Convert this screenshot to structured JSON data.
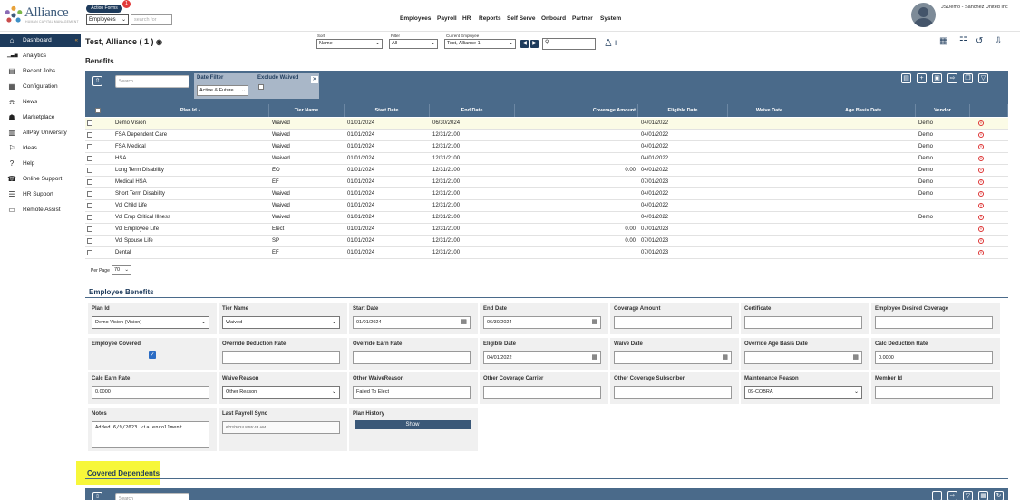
{
  "header": {
    "logo_text": "Alliance",
    "logo_subtext": "HUMAN CAPITAL MANAGEMENT",
    "action_forms": "Action Forms",
    "badge_count": "1",
    "employee_select": "Employees",
    "search_placeholder": "search for",
    "nav": [
      "Employees",
      "Payroll",
      "HR",
      "Reports",
      "Self Serve",
      "Onboard",
      "Partner",
      "System"
    ],
    "active_nav": "HR",
    "user_name": "JSDemo - Sanchez United Inc"
  },
  "sidebar": {
    "items": [
      {
        "label": "Dashboard",
        "icon": "home-icon"
      },
      {
        "label": "Analytics",
        "icon": "analytics-icon"
      },
      {
        "label": "Recent Jobs",
        "icon": "jobs-icon"
      },
      {
        "label": "Configuration",
        "icon": "configuration-icon"
      },
      {
        "label": "News",
        "icon": "bell-icon"
      },
      {
        "label": "Marketplace",
        "icon": "marketplace-icon"
      },
      {
        "label": "AllPay University",
        "icon": "university-icon"
      },
      {
        "label": "Ideas",
        "icon": "lightbulb-icon"
      },
      {
        "label": "Help",
        "icon": "help-icon"
      },
      {
        "label": "Online Support",
        "icon": "headset-icon"
      },
      {
        "label": "HR Support",
        "icon": "hr-support-icon"
      },
      {
        "label": "Remote Assist",
        "icon": "monitor-icon"
      }
    ]
  },
  "page": {
    "title": "Test, Alliance ( 1 )",
    "sort_label": "Sort",
    "sort_value": "Name",
    "filter_label": "Filter",
    "filter_value": "All",
    "current_employee_label": "Current Employee",
    "current_employee_value": "Test, Alliance 1"
  },
  "benefits": {
    "section_title": "Benefits",
    "search_placeholder": "Search",
    "date_filter_label": "Date Filter",
    "date_filter_value": "Active & Future",
    "exclude_waived_label": "Exclude Waived",
    "columns": [
      "Plan Id ▴",
      "Tier Name",
      "Start Date",
      "End Date",
      "Coverage Amount",
      "Eligible Date",
      "Waive Date",
      "Age Basis Date",
      "Vendor"
    ],
    "rows": [
      {
        "plan": "Demo Vision",
        "tier": "Waived",
        "start": "01/01/2024",
        "end": "06/30/2024",
        "coverage": "",
        "eligible": "04/01/2022",
        "waive": "",
        "age": "",
        "vendor": "Demo"
      },
      {
        "plan": "FSA Dependent Care",
        "tier": "Waived",
        "start": "01/01/2024",
        "end": "12/31/2100",
        "coverage": "",
        "eligible": "04/01/2022",
        "waive": "",
        "age": "",
        "vendor": "Demo"
      },
      {
        "plan": "FSA Medical",
        "tier": "Waived",
        "start": "01/01/2024",
        "end": "12/31/2100",
        "coverage": "",
        "eligible": "04/01/2022",
        "waive": "",
        "age": "",
        "vendor": "Demo"
      },
      {
        "plan": "HSA",
        "tier": "Waived",
        "start": "01/01/2024",
        "end": "12/31/2100",
        "coverage": "",
        "eligible": "04/01/2022",
        "waive": "",
        "age": "",
        "vendor": "Demo"
      },
      {
        "plan": "Long Term Disability",
        "tier": "EO",
        "start": "01/01/2024",
        "end": "12/31/2100",
        "coverage": "0.00",
        "eligible": "04/01/2022",
        "waive": "",
        "age": "",
        "vendor": "Demo"
      },
      {
        "plan": "Medical HSA",
        "tier": "EF",
        "start": "01/01/2024",
        "end": "12/31/2100",
        "coverage": "",
        "eligible": "07/01/2023",
        "waive": "",
        "age": "",
        "vendor": "Demo"
      },
      {
        "plan": "Short Term Disability",
        "tier": "Waived",
        "start": "01/01/2024",
        "end": "12/31/2100",
        "coverage": "",
        "eligible": "04/01/2022",
        "waive": "",
        "age": "",
        "vendor": "Demo"
      },
      {
        "plan": "Vol Child Life",
        "tier": "Waived",
        "start": "01/01/2024",
        "end": "12/31/2100",
        "coverage": "",
        "eligible": "04/01/2022",
        "waive": "",
        "age": "",
        "vendor": ""
      },
      {
        "plan": "Vol Emp Critical Illness",
        "tier": "Waived",
        "start": "01/01/2024",
        "end": "12/31/2100",
        "coverage": "",
        "eligible": "04/01/2022",
        "waive": "",
        "age": "",
        "vendor": "Demo"
      },
      {
        "plan": "Vol Employee Life",
        "tier": "Elect",
        "start": "01/01/2024",
        "end": "12/31/2100",
        "coverage": "0.00",
        "eligible": "07/01/2023",
        "waive": "",
        "age": "",
        "vendor": ""
      },
      {
        "plan": "Vol Spouse Life",
        "tier": "SP",
        "start": "01/01/2024",
        "end": "12/31/2100",
        "coverage": "0.00",
        "eligible": "07/01/2023",
        "waive": "",
        "age": "",
        "vendor": ""
      },
      {
        "plan": "Dental",
        "tier": "EF",
        "start": "01/01/2024",
        "end": "12/31/2100",
        "coverage": "",
        "eligible": "07/01/2023",
        "waive": "",
        "age": "",
        "vendor": ""
      }
    ],
    "per_page_label": "Per Page",
    "per_page_value": "70"
  },
  "employee_benefits": {
    "section_title": "Employee Benefits",
    "fields": [
      {
        "label": "Plan Id",
        "value": "Demo Vision (Vision)",
        "kind": "select"
      },
      {
        "label": "Tier Name",
        "value": "Waived",
        "kind": "select"
      },
      {
        "label": "Start Date",
        "value": "01/01/2024",
        "kind": "date"
      },
      {
        "label": "End Date",
        "value": "06/30/2024",
        "kind": "date"
      },
      {
        "label": "Coverage Amount",
        "value": "",
        "kind": "text"
      },
      {
        "label": "Certificate",
        "value": "",
        "kind": "text"
      },
      {
        "label": "Employee Desired Coverage",
        "value": "",
        "kind": "text"
      },
      {
        "label": "Employee Covered",
        "value": "checked",
        "kind": "checkbox"
      },
      {
        "label": "Override Deduction Rate",
        "value": "",
        "kind": "text"
      },
      {
        "label": "Override Earn Rate",
        "value": "",
        "kind": "text"
      },
      {
        "label": "Eligible Date",
        "value": "04/01/2022",
        "kind": "date"
      },
      {
        "label": "Waive Date",
        "value": "",
        "kind": "date"
      },
      {
        "label": "Override Age Basis Date",
        "value": "",
        "kind": "date"
      },
      {
        "label": "Calc Deduction Rate",
        "value": "0.0000",
        "kind": "text"
      },
      {
        "label": "Calc Earn Rate",
        "value": "0.0000",
        "kind": "text"
      },
      {
        "label": "Waive Reason",
        "value": "Other Reason",
        "kind": "select"
      },
      {
        "label": "Other WaiveReason",
        "value": "Failed To Elect",
        "kind": "text"
      },
      {
        "label": "Other Coverage Carrier",
        "value": "",
        "kind": "text"
      },
      {
        "label": "Other Coverage Subscriber",
        "value": "",
        "kind": "text"
      },
      {
        "label": "Maintenance Reason",
        "value": "09-COBRA",
        "kind": "select"
      },
      {
        "label": "Member Id",
        "value": "",
        "kind": "text"
      },
      {
        "label": "Notes",
        "value": "Added 6/9/2023 via enrollment",
        "kind": "textarea"
      },
      {
        "label": "Last Payroll Sync",
        "value": "6/23/2024 8:55:43 AM",
        "kind": "readonly"
      },
      {
        "label": "Plan History",
        "value": "Show",
        "kind": "button"
      }
    ]
  },
  "covered_dependents": {
    "section_title": "Covered Dependents",
    "search_placeholder": "Search"
  }
}
